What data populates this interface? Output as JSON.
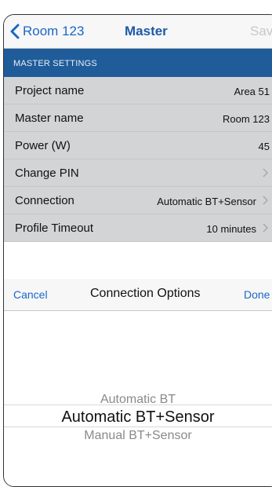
{
  "nav": {
    "back_label": "Room 123",
    "title": "Master",
    "save_label": "Save"
  },
  "section": {
    "header": "MASTER SETTINGS"
  },
  "rows": [
    {
      "label": "Project name",
      "value": "Area 51",
      "chevron": false
    },
    {
      "label": "Master name",
      "value": "Room 123",
      "chevron": false
    },
    {
      "label": "Power (W)",
      "value": "45",
      "chevron": false
    },
    {
      "label": "Change PIN",
      "value": "",
      "chevron": true
    },
    {
      "label": "Connection",
      "value": "Automatic BT+Sensor",
      "chevron": true
    },
    {
      "label": "Profile Timeout",
      "value": "10 minutes",
      "chevron": true
    }
  ],
  "picker": {
    "cancel_label": "Cancel",
    "title": "Connection Options",
    "done_label": "Done",
    "options": [
      "Automatic BT",
      "Automatic BT+Sensor",
      "Manual BT+Sensor"
    ],
    "selected_index": 1
  },
  "colors": {
    "accent": "#1b67c7",
    "header_bar": "#1f5c99",
    "row_bg": "#d3d4d6"
  }
}
